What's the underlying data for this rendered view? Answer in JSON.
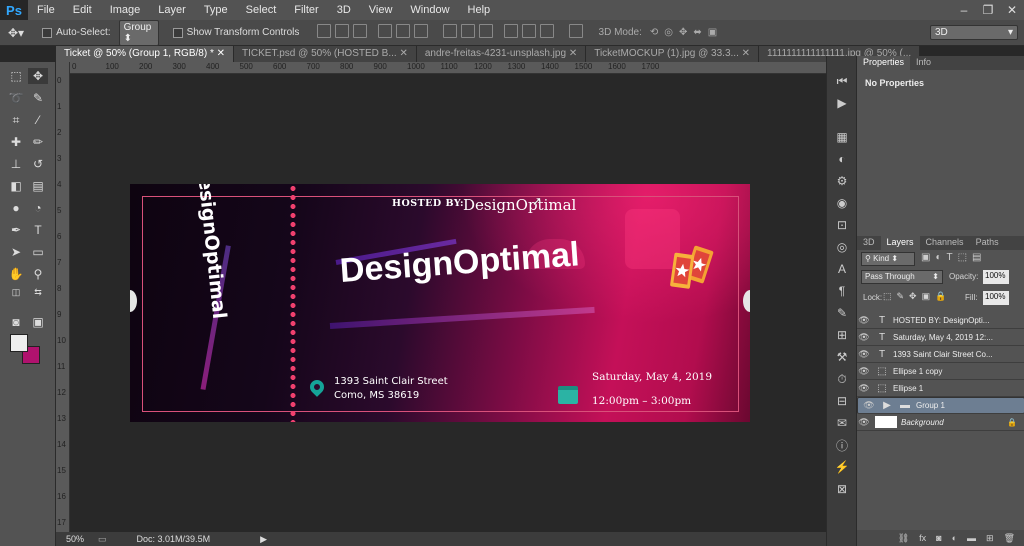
{
  "app": {
    "logo": "Ps"
  },
  "menu": [
    "File",
    "Edit",
    "Image",
    "Layer",
    "Type",
    "Select",
    "Filter",
    "3D",
    "View",
    "Window",
    "Help"
  ],
  "options_bar": {
    "auto_select_label": "Auto-Select:",
    "auto_select_value": "Group",
    "show_transform_label": "Show Transform Controls",
    "mode_3d_label": "3D Mode:",
    "workspace_value": "3D"
  },
  "tabs": [
    "Ticket @ 50% (Group 1, RGB/8) *",
    "TICKET.psd @ 50% (HOSTED B...",
    "andre-freitas-4231-unsplash.jpg",
    "TicketMOCKUP (1).jpg @ 33.3...",
    "1111111111111111.jpg @ 50% (..."
  ],
  "ruler_h": [
    "0",
    "100",
    "200",
    "300",
    "400",
    "500",
    "600",
    "700",
    "800",
    "900",
    "1000",
    "1100",
    "1200",
    "1300",
    "1400",
    "1500",
    "1600",
    "1700"
  ],
  "ruler_v": [
    "0",
    "1",
    "2",
    "3",
    "4",
    "5",
    "6",
    "7",
    "8",
    "9",
    "10",
    "11",
    "12",
    "13",
    "14",
    "15",
    "16",
    "17"
  ],
  "ticket": {
    "side_brand": "DesignOptimal",
    "hosted_by_label": "HOSTED BY:",
    "hosted_by_name": "DesignOptimal",
    "main_title": "DesignOptimal",
    "address_line1": "1393 Saint Clair Street",
    "address_line2": "Como, MS 38619",
    "date": "Saturday, May 4, 2019",
    "time": "12:00pm – 3:00pm"
  },
  "status_bar": {
    "zoom": "50%",
    "doc": "Doc: 3.01M/39.5M"
  },
  "properties_panel": {
    "tabs": [
      "Properties",
      "Info"
    ],
    "content": "No Properties"
  },
  "layers_panel": {
    "tabs": [
      "3D",
      "Layers",
      "Channels",
      "Paths"
    ],
    "filter_kind": "Kind",
    "blend_mode": "Pass Through",
    "opacity_label": "Opacity:",
    "opacity_value": "100%",
    "lock_label": "Lock:",
    "fill_label": "Fill:",
    "fill_value": "100%",
    "layers": [
      {
        "name": "HOSTED BY:    DesignOpti...",
        "type": "T"
      },
      {
        "name": "Saturday, May 4, 2019 12:...",
        "type": "T"
      },
      {
        "name": "1393 Saint Clair Street Co...",
        "type": "T"
      },
      {
        "name": "Ellipse 1 copy",
        "type": "shape"
      },
      {
        "name": "Ellipse 1",
        "type": "shape"
      },
      {
        "name": "Group 1",
        "type": "group"
      },
      {
        "name": "Background",
        "type": "bg"
      }
    ]
  },
  "colors": {
    "accent_pink": "#c41058",
    "frame": "#d9517a",
    "teal": "#15a398",
    "bg_swatch": "#b0126e",
    "selected_layer": "#6d7e92"
  }
}
